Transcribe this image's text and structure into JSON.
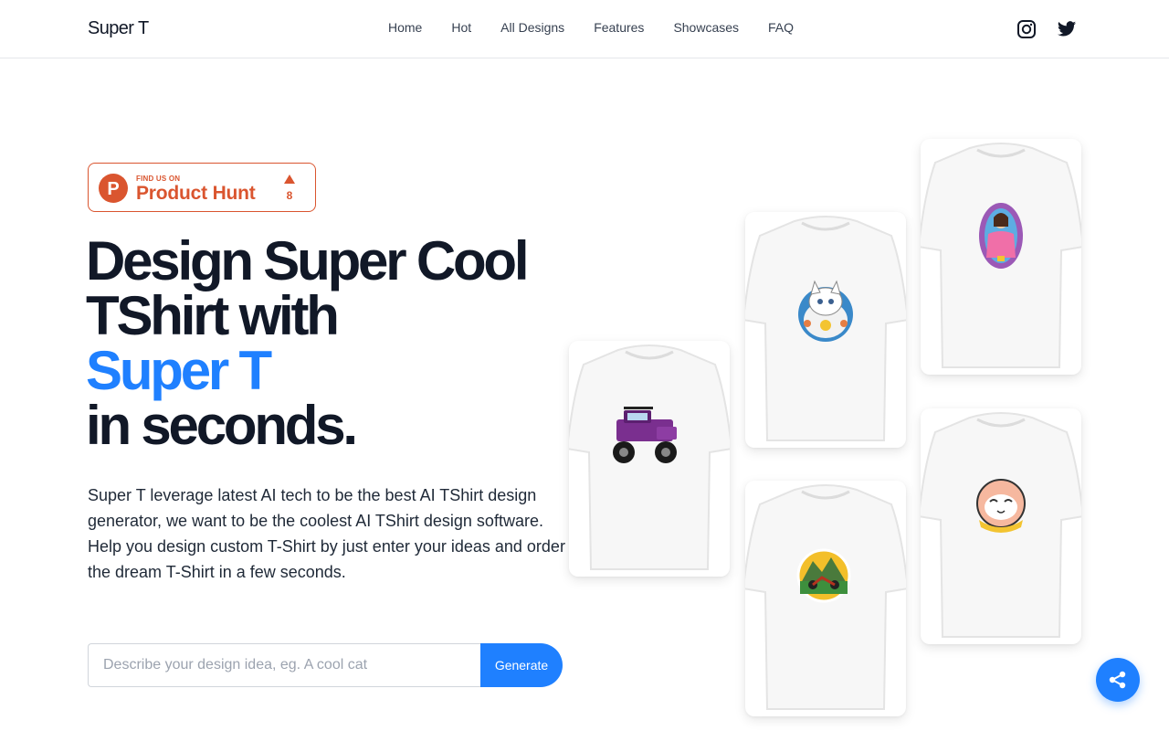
{
  "header": {
    "logo": "Super T",
    "nav": [
      "Home",
      "Hot",
      "All Designs",
      "Features",
      "Showcases",
      "FAQ"
    ],
    "social_icons": [
      "instagram-icon",
      "twitter-icon"
    ]
  },
  "product_hunt": {
    "small_label": "FIND US ON",
    "name": "Product Hunt",
    "logo_letter": "P",
    "upvotes": "8",
    "color": "#da552f"
  },
  "hero": {
    "line1": "Design Super Cool",
    "line2": "TShirt with",
    "accent": "Super T",
    "line4": "in seconds.",
    "description": "Super T leverage latest AI tech to be the best AI TShirt design generator, we want to be the coolest AI TShirt design software. Help you design custom T-Shirt by just enter your ideas and order the dream T-Shirt in a few seconds."
  },
  "generator": {
    "placeholder": "Describe your design idea, eg. A cool cat",
    "button_label": "Generate"
  },
  "showcase": [
    "monster-truck-design",
    "white-cat-design",
    "mountain-motorcycle-design",
    "saint-girl-design",
    "happy-cat-design"
  ],
  "share_icon": "share-icon",
  "colors": {
    "accent": "#1f80ff",
    "text": "#111827",
    "product_hunt": "#da552f"
  }
}
